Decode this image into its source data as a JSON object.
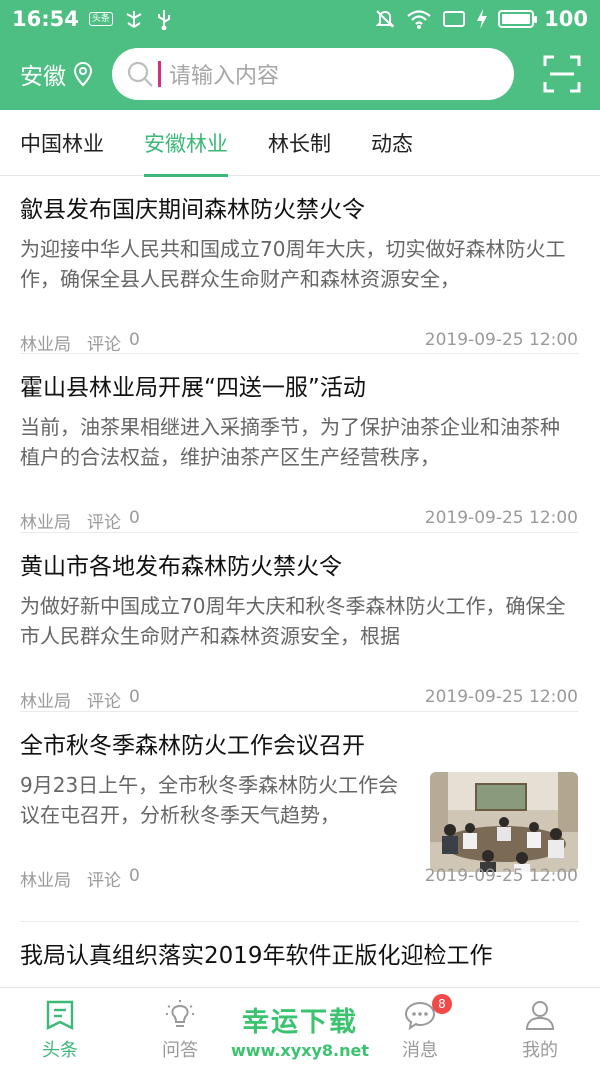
{
  "status_bar": {
    "time": "16:54",
    "notif_badge": "头条",
    "battery_level": 100,
    "battery_text": "100"
  },
  "header": {
    "city": "安徽",
    "search_placeholder": "请输入内容"
  },
  "tabs": [
    {
      "label": "中国林业",
      "active": false
    },
    {
      "label": "安徽林业",
      "active": true
    },
    {
      "label": "林长制",
      "active": false
    },
    {
      "label": "动态",
      "active": false
    }
  ],
  "news": [
    {
      "title": "歙县发布国庆期间森林防火禁火令",
      "summary": "为迎接中华人民共和国成立70周年大庆，切实做好森林防火工作，确保全县人民群众生命财产和森林资源安全，",
      "source": "林业局",
      "comment_label": "评论",
      "comment_count": "0",
      "date": "2019-09-25 12:00"
    },
    {
      "title": "霍山县林业局开展“四送一服”活动",
      "summary": "当前，油茶果相继进入采摘季节，为了保护油茶企业和油茶种植户的合法权益，维护油茶产区生产经营秩序，",
      "source": "林业局",
      "comment_label": "评论",
      "comment_count": "0",
      "date": "2019-09-25 12:00"
    },
    {
      "title": "黄山市各地发布森林防火禁火令",
      "summary": "为做好新中国成立70周年大庆和秋冬季森林防火工作，确保全市人民群众生命财产和森林资源安全，根据",
      "source": "林业局",
      "comment_label": "评论",
      "comment_count": "0",
      "date": "2019-09-25 12:00"
    },
    {
      "title": "全市秋冬季森林防火工作会议召开",
      "summary": "9月23日上午，全市秋冬季森林防火工作会议在屯召开，分析秋冬季天气趋势，",
      "source": "林业局",
      "comment_label": "评论",
      "comment_count": "0",
      "date": "2019-09-25 12:00",
      "has_thumbnail": true
    },
    {
      "title": "我局认真组织落实2019年软件正版化迎检工作"
    }
  ],
  "bottom_nav": [
    {
      "label": "头条",
      "icon": "headline-icon",
      "active": true
    },
    {
      "label": "问答",
      "icon": "bulb-icon",
      "active": false
    },
    {
      "label": "",
      "icon": "",
      "active": false
    },
    {
      "label": "消息",
      "icon": "chat-icon",
      "active": false,
      "badge": "8"
    },
    {
      "label": "我的",
      "icon": "user-icon",
      "active": false
    }
  ],
  "watermark": {
    "line1": "幸运下载",
    "line2": "www.xyxy8.net"
  },
  "colors": {
    "brand_green": "#4dbf82",
    "active_green": "#3cb878",
    "badge_red": "#f24949"
  }
}
